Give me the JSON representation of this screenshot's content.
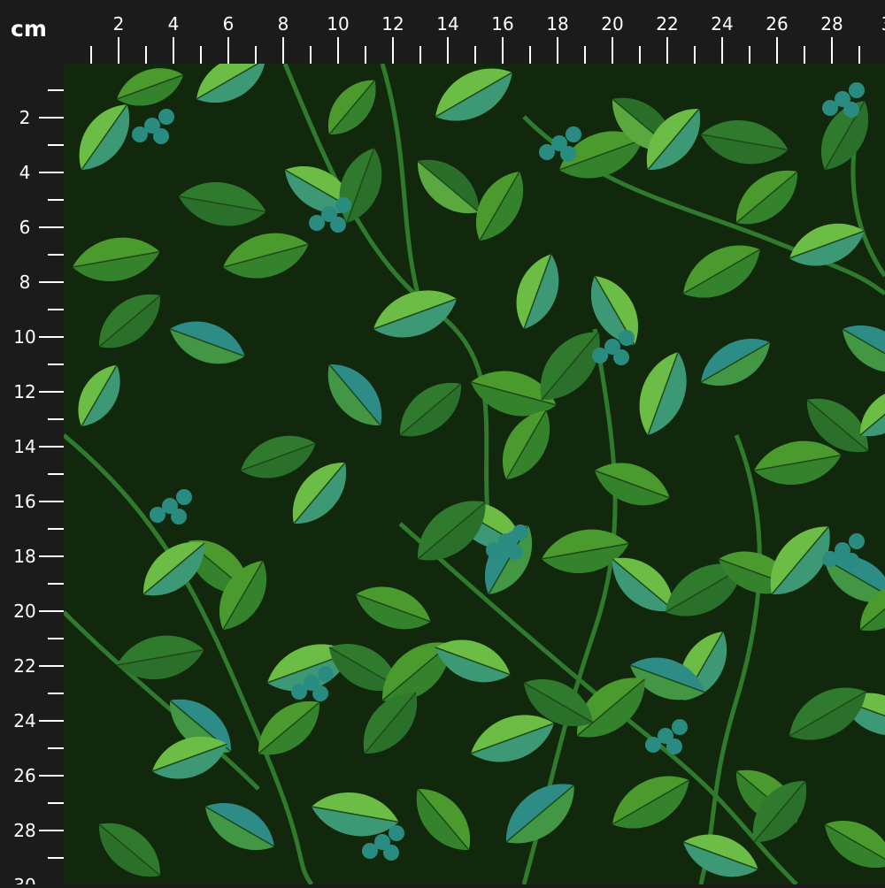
{
  "ruler": {
    "unit": "cm",
    "top_labels": [
      "2",
      "4",
      "6",
      "8",
      "10",
      "12",
      "14",
      "16",
      "18",
      "20",
      "22",
      "24",
      "26",
      "28",
      "3"
    ],
    "left_labels": [
      "2",
      "4",
      "6",
      "8",
      "10",
      "12",
      "14",
      "16",
      "18",
      "20",
      "22",
      "24",
      "26",
      "28",
      "30"
    ]
  },
  "fabric": {
    "pattern": "leafy-vine",
    "background_color": "#12280c",
    "leaf_colors": [
      "#4a9a2e",
      "#6cbd45",
      "#2f7a2c",
      "#2e8c86",
      "#2b6e2a"
    ],
    "stem_color": "#2f7a2c",
    "berry_color": "#2a8c80"
  }
}
